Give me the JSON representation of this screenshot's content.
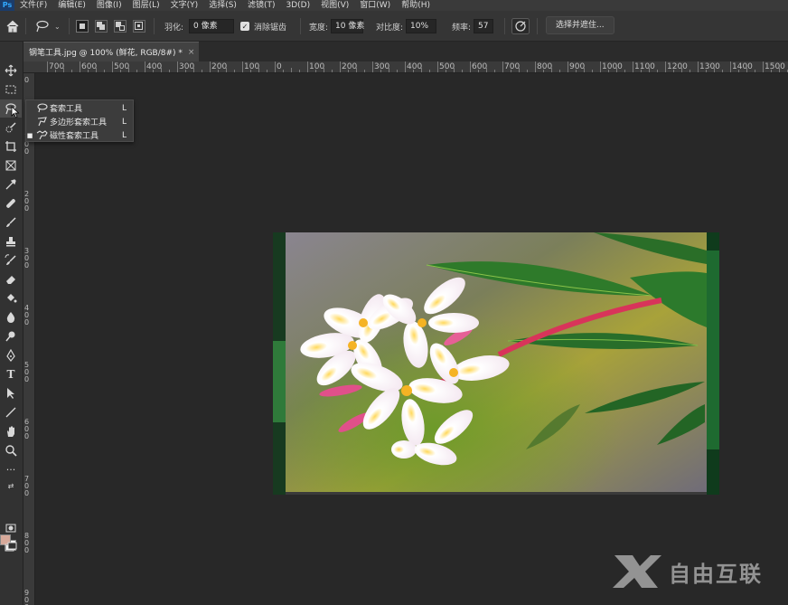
{
  "menubar": {
    "items": [
      "文件(F)",
      "编辑(E)",
      "图像(I)",
      "图层(L)",
      "文字(Y)",
      "选择(S)",
      "滤镜(T)",
      "3D(D)",
      "视图(V)",
      "窗口(W)",
      "帮助(H)"
    ]
  },
  "options": {
    "feather_label": "羽化:",
    "feather_value": "0 像素",
    "antialias_label": "消除锯齿",
    "antialias_checked": true,
    "width_label": "宽度:",
    "width_value": "10 像素",
    "contrast_label": "对比度:",
    "contrast_value": "10%",
    "frequency_label": "频率:",
    "frequency_value": "57",
    "select_mask_button": "选择并遮住..."
  },
  "document": {
    "tab_title": "钢笔工具.jpg @ 100% (鲜花, RGB/8#) *",
    "close": "×"
  },
  "ruler": {
    "top_labels": [
      "700",
      "600",
      "500",
      "400",
      "300",
      "200",
      "100",
      "0",
      "100",
      "200",
      "300",
      "400",
      "500",
      "600",
      "700",
      "800",
      "900",
      "1000",
      "1100",
      "1200",
      "1300",
      "1400",
      "1500"
    ],
    "left_labels": [
      "0",
      "1 0 0",
      "2 0 0",
      "3 0 0",
      "4 0 0",
      "5 0 0",
      "6 0 0",
      "7 0 0",
      "8 0 0",
      "9 0 0"
    ]
  },
  "flyout": {
    "items": [
      {
        "label": "套索工具",
        "key": "L",
        "icon": "lasso-icon",
        "selected": false
      },
      {
        "label": "多边形套索工具",
        "key": "L",
        "icon": "polygonal-lasso-icon",
        "selected": false
      },
      {
        "label": "磁性套索工具",
        "key": "L",
        "icon": "magnetic-lasso-icon",
        "selected": true
      }
    ]
  },
  "colors": {
    "foreground": "#d7a99a",
    "background": "#ffffff"
  },
  "watermark": {
    "text": "自由互联"
  }
}
